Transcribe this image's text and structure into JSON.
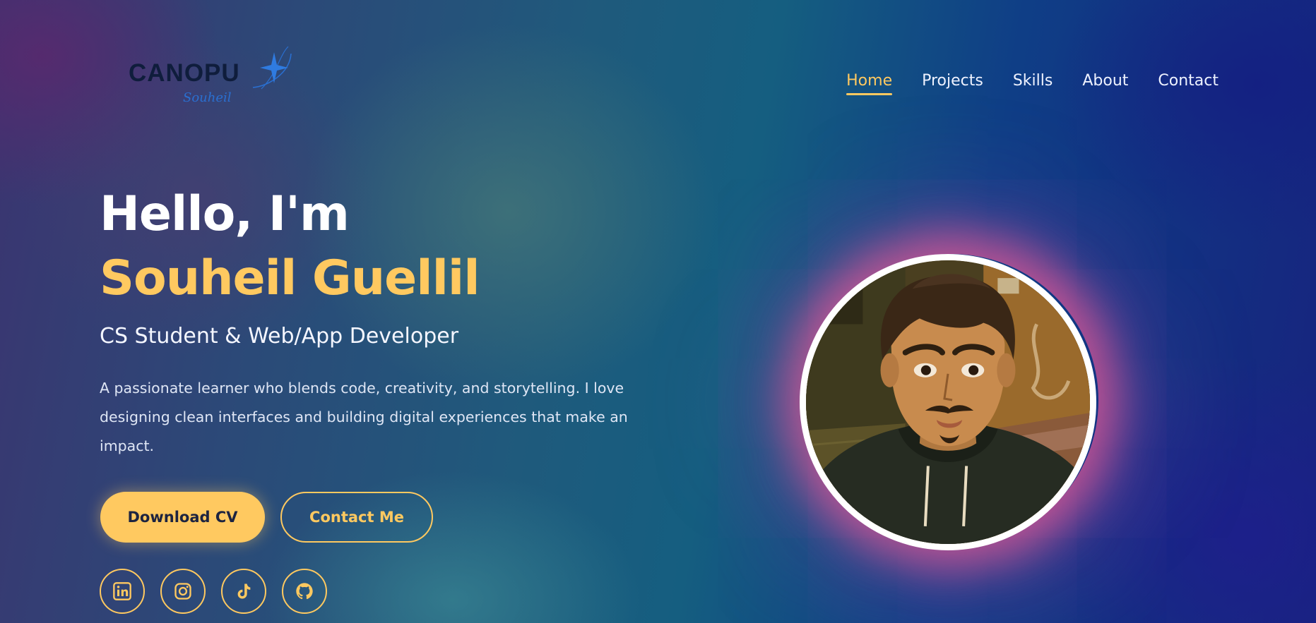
{
  "logo": {
    "wordmark": "CANOPU",
    "signature": "Souheil"
  },
  "nav": {
    "items": [
      {
        "label": "Home",
        "active": true
      },
      {
        "label": "Projects",
        "active": false
      },
      {
        "label": "Skills",
        "active": false
      },
      {
        "label": "About",
        "active": false
      },
      {
        "label": "Contact",
        "active": false
      }
    ]
  },
  "hero": {
    "greeting": "Hello, I'm",
    "name": "Souheil Guellil",
    "subtitle": "CS Student & Web/App Developer",
    "description": "A passionate learner who blends code, creativity, and storytelling. I love designing clean interfaces and building digital experiences that make an impact."
  },
  "buttons": {
    "download_cv": "Download CV",
    "contact_me": "Contact Me"
  },
  "socials": [
    {
      "icon": "linkedin-icon"
    },
    {
      "icon": "instagram-icon"
    },
    {
      "icon": "tiktok-icon"
    },
    {
      "icon": "github-icon"
    }
  ],
  "portrait": {
    "subject": "avatar illustration"
  },
  "colors": {
    "accent": "#ffc960",
    "text": "#ffffff",
    "glow": "#e65a96"
  }
}
